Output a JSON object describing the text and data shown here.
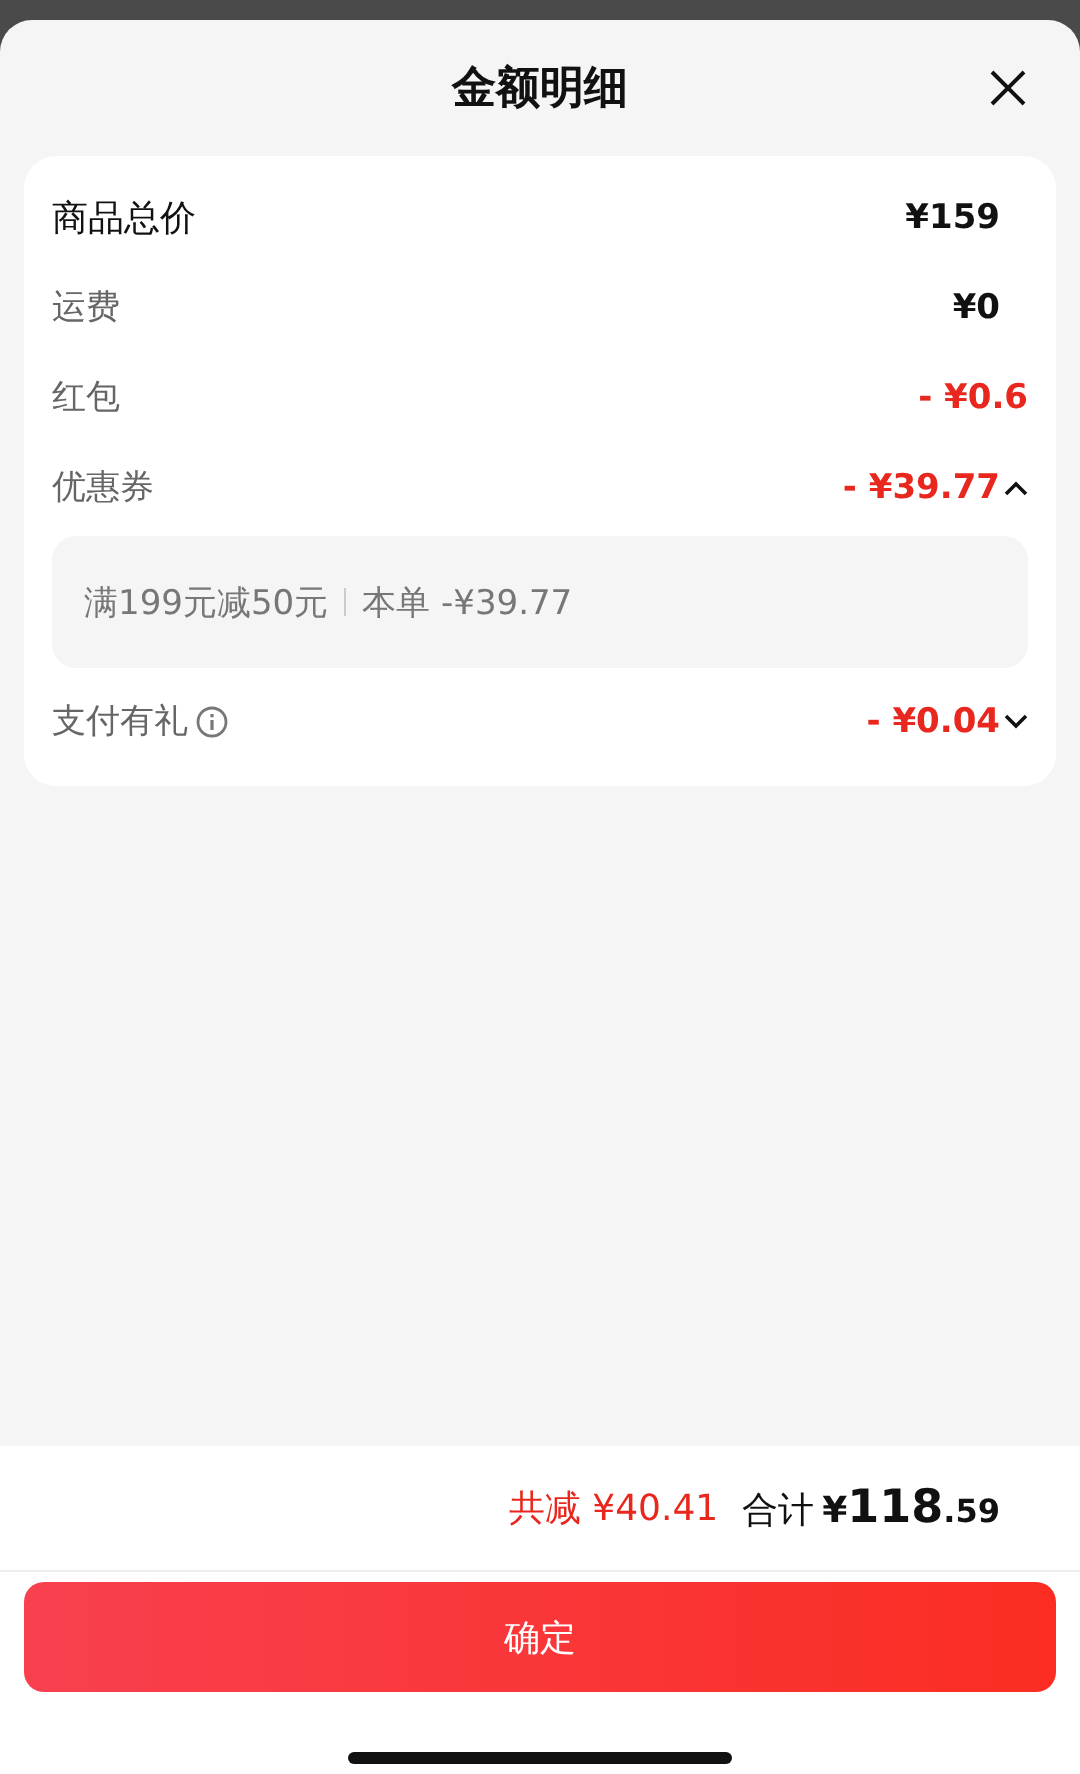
{
  "sheet": {
    "title": "金额明细"
  },
  "rows": [
    {
      "kind": "main",
      "label": "商品总价",
      "amount": "¥159",
      "discount": false
    },
    {
      "kind": "normal",
      "label": "运费",
      "amount": "¥0",
      "discount": false
    },
    {
      "kind": "normal",
      "label": "红包",
      "amount": "- ¥0.6",
      "discount": true
    },
    {
      "kind": "expandable",
      "label": "优惠券",
      "amount": "- ¥39.77",
      "discount": true,
      "expanded": true,
      "detail": {
        "rule": "满199元减50元",
        "applied": "本单 -¥39.77"
      }
    },
    {
      "kind": "expandable",
      "label": "支付有礼",
      "amount": "- ¥0.04",
      "discount": true,
      "expanded": false,
      "info": true
    }
  ],
  "summary": {
    "saved": "共减 ¥40.41",
    "total_label": "合计",
    "currency": "¥",
    "integer": "118",
    "decimal": ".59"
  },
  "confirm_button": "确定"
}
